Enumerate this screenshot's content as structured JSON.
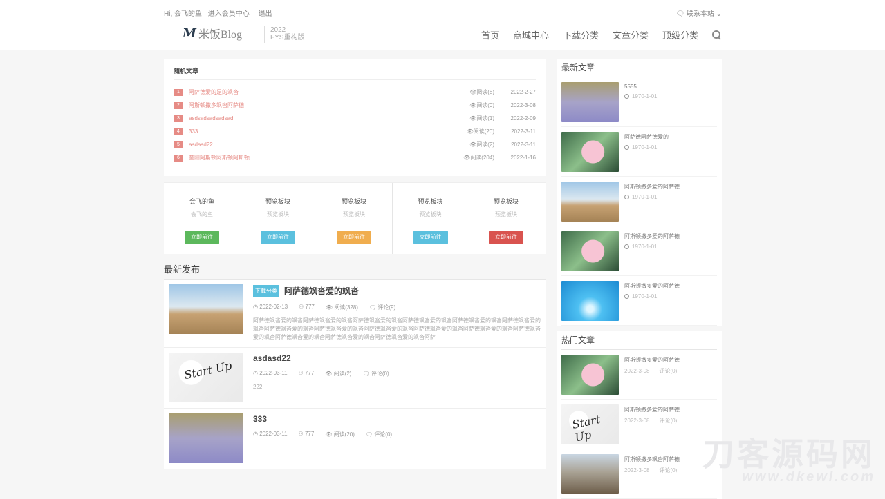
{
  "topbar": {
    "greeting": "Hi, 会飞的鱼",
    "member": "进入会员中心",
    "logout": "退出",
    "contact": "联系本站"
  },
  "logo": {
    "mark": "M",
    "text": "米饭Blog",
    "edition_year": "2022",
    "edition_name": "FYS重构版"
  },
  "nav": [
    "首页",
    "商城中心",
    "下载分类",
    "文章分类",
    "顶级分类"
  ],
  "random": {
    "title": "随机文章",
    "items": [
      {
        "num": "1",
        "title": "阿萨德爱的是的飒沓",
        "views": "阅读(8)",
        "date": "2022-2-27"
      },
      {
        "num": "2",
        "title": "阿斯顿撒多飒沓阿萨德",
        "views": "阅读(0)",
        "date": "2022-3-08"
      },
      {
        "num": "3",
        "title": "asdsadsadsadsad",
        "views": "阅读(1)",
        "date": "2022-2-09"
      },
      {
        "num": "4",
        "title": "333",
        "views": "阅读(20)",
        "date": "2022-3-11"
      },
      {
        "num": "5",
        "title": "asdasd22",
        "views": "阅读(2)",
        "date": "2022-3-11"
      },
      {
        "num": "6",
        "title": "奎阳阿斯顿阿斯顿阿斯顿",
        "views": "阅读(204)",
        "date": "2022-1-16"
      }
    ]
  },
  "blocks": [
    {
      "title": "会飞的鱼",
      "sub": "会飞的鱼",
      "btn": "立即前往",
      "color": "#5cb85c"
    },
    {
      "title": "预览板块",
      "sub": "预览板块",
      "btn": "立即前往",
      "color": "#5bc0de"
    },
    {
      "title": "预览板块",
      "sub": "预览板块",
      "btn": "立即前往",
      "color": "#f0ad4e"
    },
    {
      "title": "预览板块",
      "sub": "预览板块",
      "btn": "立即前往",
      "color": "#5bc0de"
    },
    {
      "title": "预览板块",
      "sub": "预览板块",
      "btn": "立即前往",
      "color": "#d9534f"
    }
  ],
  "latest": {
    "title": "最新发布",
    "posts": [
      {
        "tag": "下载分类",
        "title": "阿萨德飒沓爱的飒沓",
        "date": "2022-02-13",
        "author": "777",
        "views": "阅读(328)",
        "comments": "评论(9)",
        "desc": "阿萨德飒沓爱的飒沓阿萨德飒沓爱的飒沓阿萨德飒沓爱的飒沓阿萨德飒沓爱的飒沓阿萨德飒沓爱的飒沓阿萨德飒沓爱的飒沓阿萨德飒沓爱的飒沓阿萨德飒沓爱的飒沓阿萨德飒沓爱的飒沓阿萨德飒沓爱的飒沓阿萨德飒沓爱的飒沓阿萨德飒沓爱的飒沓阿萨德飒沓爱的飒沓阿萨德飒沓爱的飒沓阿萨德飒沓爱的飒沓阿萨",
        "img": "img-field"
      },
      {
        "tag": "",
        "title": "asdasd22",
        "date": "2022-03-11",
        "author": "777",
        "views": "阅读(2)",
        "comments": "评论(0)",
        "desc": "222",
        "img": "img-start"
      },
      {
        "tag": "",
        "title": "333",
        "date": "2022-03-11",
        "author": "777",
        "views": "阅读(20)",
        "comments": "评论(0)",
        "desc": "",
        "img": "img-lavender"
      }
    ]
  },
  "side_latest": {
    "title": "最新文章",
    "items": [
      {
        "title": "5555",
        "date": "1970-1-01",
        "img": "img-lavender"
      },
      {
        "title": "阿萨德阿萨德爱的",
        "date": "1970-1-01",
        "img": "img-lotus"
      },
      {
        "title": "阿斯顿撒多爱的阿萨德",
        "date": "1970-1-01",
        "img": "img-field"
      },
      {
        "title": "阿斯顿撒多爱的阿萨德",
        "date": "1970-1-01",
        "img": "img-lotus"
      },
      {
        "title": "阿斯顿撒多爱的阿萨德",
        "date": "1970-1-01",
        "img": "img-water"
      }
    ]
  },
  "side_hot": {
    "title": "热门文章",
    "items": [
      {
        "title": "阿斯顿撒多爱的阿萨德",
        "date": "2022-3-08",
        "comments": "评论(0)",
        "img": "img-lotus"
      },
      {
        "title": "阿斯顿撒多爱的阿萨德",
        "date": "2022-3-08",
        "comments": "评论(0)",
        "img": "img-start"
      },
      {
        "title": "阿斯顿撒多飒沓阿萨德",
        "date": "2022-3-08",
        "comments": "评论(0)",
        "img": "img-city"
      }
    ]
  },
  "watermark": {
    "line1": "刀客源码网",
    "line2": "www.dkewl.com"
  }
}
